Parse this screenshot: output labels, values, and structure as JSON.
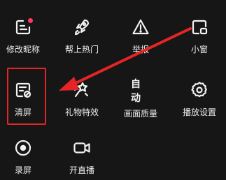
{
  "colors": {
    "background": "#161616",
    "notification_dot": "#ff3b5c",
    "annotation": "#e52525"
  },
  "rows": [
    [
      {
        "name": "edit-profile",
        "icon": "edit-profile-icon",
        "label": "修改昵称",
        "badge": true
      },
      {
        "name": "boost-trending",
        "icon": "rocket-icon",
        "label": "帮上热门"
      },
      {
        "name": "report",
        "icon": "warning-icon",
        "label": "举报"
      },
      {
        "name": "mini-window",
        "icon": "picture-in-picture-icon",
        "label": "小窗"
      }
    ],
    [
      {
        "name": "clear-screen",
        "icon": "clear-screen-icon",
        "label": "清屏"
      },
      {
        "name": "gift-effects",
        "icon": "gift-effects-icon",
        "label": "礼物特效"
      },
      {
        "name": "picture-quality",
        "icon": "auto-text",
        "icon_text": "自动",
        "label": "画面质量"
      },
      {
        "name": "playback-settings",
        "icon": "gear-icon",
        "label": "播放设置"
      }
    ],
    [
      {
        "name": "screen-record",
        "icon": "record-icon",
        "label": "录屏"
      },
      {
        "name": "go-live",
        "icon": "video-camera-icon",
        "label": "开直播"
      }
    ]
  ]
}
